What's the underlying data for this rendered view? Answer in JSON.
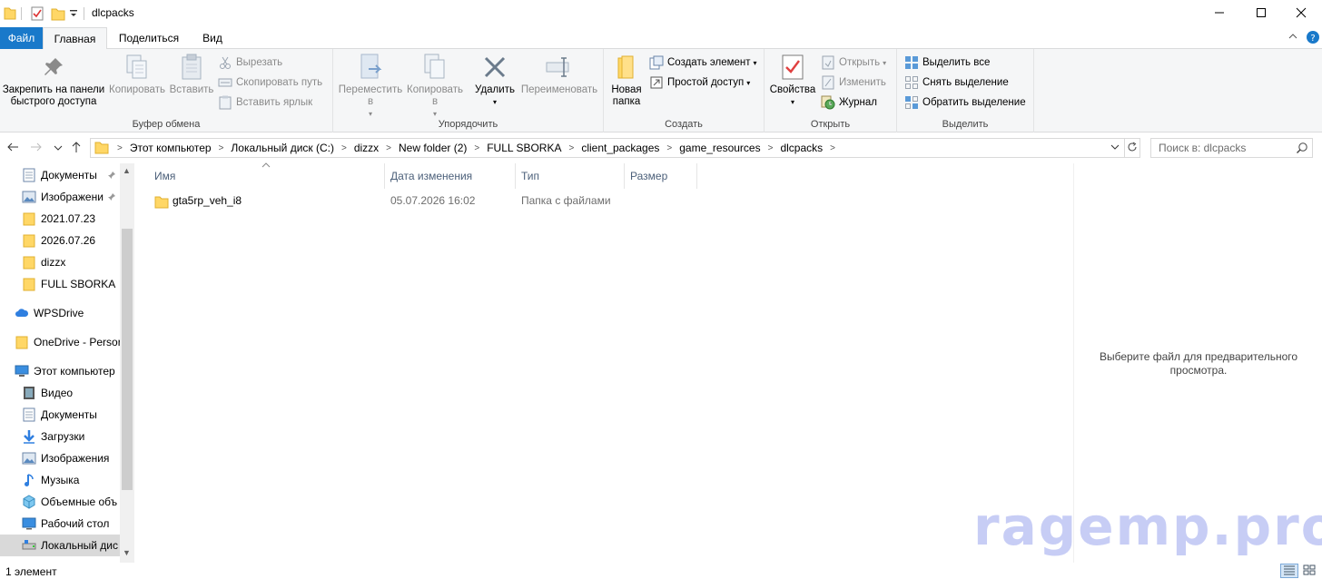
{
  "window": {
    "title": "dlcpacks",
    "minimize_icon": "minimize-icon",
    "maximize_icon": "maximize-icon",
    "close_icon": "close-icon"
  },
  "ribbon_tabs": {
    "file": "Файл",
    "home": "Главная",
    "share": "Поделиться",
    "view": "Вид"
  },
  "ribbon": {
    "clipboard": {
      "label": "Буфер обмена",
      "pin": "Закрепить на панели быстрого доступа",
      "copy": "Копировать",
      "paste": "Вставить",
      "cut": "Вырезать",
      "copy_path": "Скопировать путь",
      "paste_shortcut": "Вставить ярлык"
    },
    "organize": {
      "label": "Упорядочить",
      "move_to": "Переместить в",
      "copy_to": "Копировать в",
      "delete": "Удалить",
      "rename": "Переименовать"
    },
    "new": {
      "label": "Создать",
      "new_folder": "Новая папка",
      "new_item": "Создать элемент",
      "easy_access": "Простой доступ"
    },
    "open": {
      "label": "Открыть",
      "properties": "Свойства",
      "open": "Открыть",
      "edit": "Изменить",
      "history": "Журнал"
    },
    "select": {
      "label": "Выделить",
      "select_all": "Выделить все",
      "select_none": "Снять выделение",
      "invert": "Обратить выделение"
    }
  },
  "address": {
    "crumbs": [
      "Этот компьютер",
      "Локальный диск (C:)",
      "dizzx",
      "New folder (2)",
      "FULL SBORKA",
      "client_packages",
      "game_resources",
      "dlcpacks"
    ],
    "search_placeholder": "Поиск в: dlcpacks"
  },
  "nav_pane": {
    "items": [
      {
        "label": "Документы",
        "icon": "documents-icon",
        "pinned": true
      },
      {
        "label": "Изображени",
        "icon": "pictures-icon",
        "pinned": true
      },
      {
        "label": "2021.07.23",
        "icon": "folder-icon"
      },
      {
        "label": "2026.07.26",
        "icon": "folder-icon"
      },
      {
        "label": "dizzx",
        "icon": "folder-icon"
      },
      {
        "label": "FULL SBORKA",
        "icon": "folder-icon"
      },
      {
        "label": "WPSDrive",
        "icon": "cloud-icon"
      },
      {
        "label": "OneDrive - Persor",
        "icon": "folder-icon"
      },
      {
        "label": "Этот компьютер",
        "icon": "computer-icon"
      },
      {
        "label": "Видео",
        "icon": "video-icon"
      },
      {
        "label": "Документы",
        "icon": "documents-icon"
      },
      {
        "label": "Загрузки",
        "icon": "downloads-icon"
      },
      {
        "label": "Изображения",
        "icon": "pictures-icon"
      },
      {
        "label": "Музыка",
        "icon": "music-icon"
      },
      {
        "label": "Объемные объ",
        "icon": "3d-objects-icon"
      },
      {
        "label": "Рабочий стол",
        "icon": "desktop-icon"
      },
      {
        "label": "Локальный дис",
        "icon": "drive-icon",
        "selected": true
      }
    ]
  },
  "file_list": {
    "columns": [
      "Имя",
      "Дата изменения",
      "Тип",
      "Размер"
    ],
    "rows": [
      {
        "name": "gta5rp_veh_i8",
        "date": "05.07.2026 16:02",
        "type": "Папка с файлами",
        "size": ""
      }
    ]
  },
  "preview": {
    "text": "Выберите файл для предварительного просмотра."
  },
  "watermark": "ragemp.pro",
  "status": {
    "count": "1 элемент"
  },
  "colors": {
    "file_tab": "#1979ca",
    "ribbon_bg": "#f5f6f7",
    "folder": "#ffd766",
    "watermark": "#c7cdf5"
  }
}
